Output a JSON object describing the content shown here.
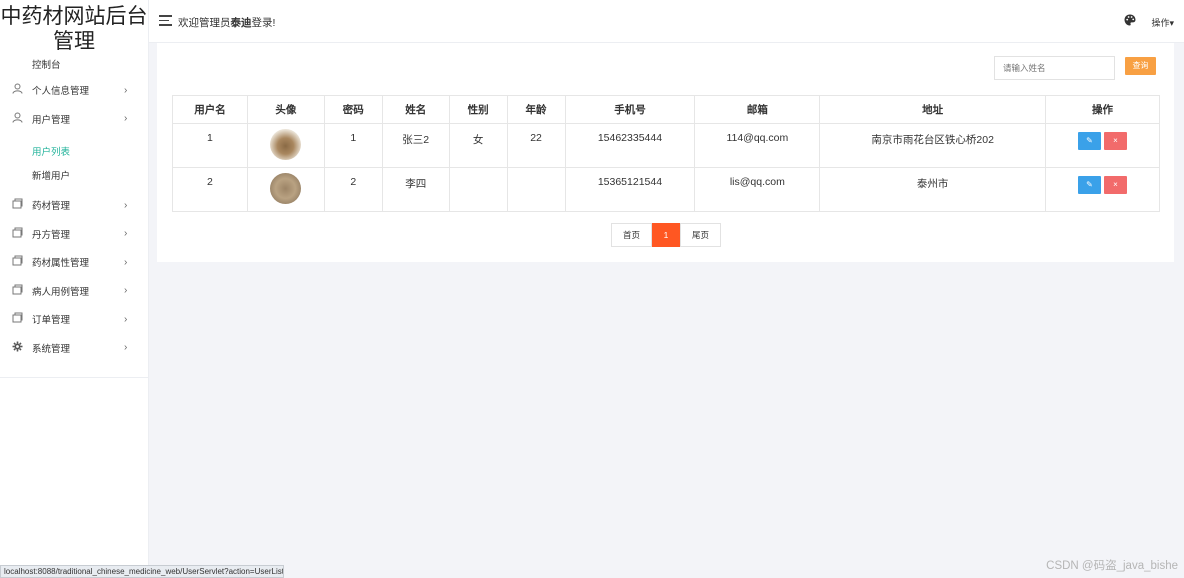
{
  "sidebar": {
    "logo": "中药材网站后台管理",
    "dashboard": "控制台",
    "items": [
      {
        "label": "个人信息管理",
        "arrow": "›"
      },
      {
        "label": "用户管理",
        "arrow": "›"
      },
      {
        "label": "药材管理",
        "arrow": "›"
      },
      {
        "label": "丹方管理",
        "arrow": "›"
      },
      {
        "label": "药材属性管理",
        "arrow": "›"
      },
      {
        "label": "病人用例管理",
        "arrow": "›"
      },
      {
        "label": "订单管理",
        "arrow": "›"
      },
      {
        "label": "系统管理",
        "arrow": "›"
      }
    ],
    "subitems": [
      {
        "label": "用户列表",
        "active": true
      },
      {
        "label": "新增用户",
        "active": false
      }
    ]
  },
  "header": {
    "welcome_prefix": "欢迎管理员",
    "admin_name": "泰迪",
    "welcome_suffix": "登录!",
    "ops": "操作▾"
  },
  "search": {
    "placeholder": "请输入姓名",
    "button": "查询"
  },
  "table": {
    "headers": [
      "用户名",
      "头像",
      "密码",
      "姓名",
      "性别",
      "年龄",
      "手机号",
      "邮箱",
      "地址",
      "操作"
    ],
    "rows": [
      {
        "username": "1",
        "password": "1",
        "name": "张三2",
        "gender": "女",
        "age": "22",
        "phone": "15462335444",
        "email": "114@qq.com",
        "address": "南京市雨花台区铁心桥202"
      },
      {
        "username": "2",
        "password": "2",
        "name": "李四",
        "gender": "",
        "age": "",
        "phone": "15365121544",
        "email": "lis@qq.com",
        "address": "泰州市"
      }
    ],
    "edit_icon": "✎",
    "delete_icon": "×"
  },
  "pager": {
    "first": "首页",
    "current": "1",
    "last": "尾页"
  },
  "statusbar": "localhost:8088/traditional_chinese_medicine_web/UserServlet?action=UserList",
  "watermark": "CSDN @码盗_java_bishe",
  "colors": {
    "accent": "#22b39a",
    "search_button": "#f8a043",
    "edit_button": "#3aa1e9",
    "delete_button": "#f26b6b",
    "current_page": "#ff5722"
  }
}
